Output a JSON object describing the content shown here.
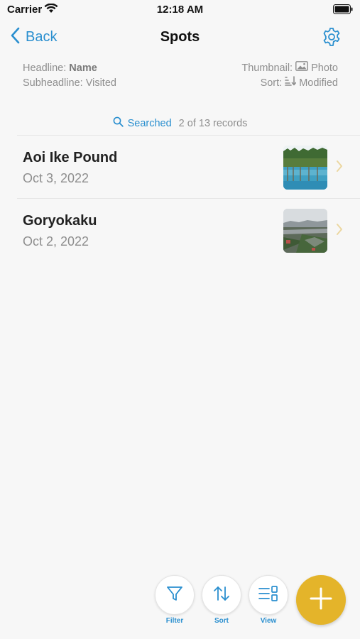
{
  "status_bar": {
    "carrier": "Carrier",
    "time": "12:18 AM"
  },
  "nav": {
    "back_label": "Back",
    "title": "Spots"
  },
  "meta": {
    "headline_label": "Headline:",
    "headline_value": "Name",
    "subheadline_label": "Subheadline:",
    "subheadline_value": "Visited",
    "thumbnail_label": "Thumbnail:",
    "thumbnail_value": "Photo",
    "sort_label": "Sort:",
    "sort_value": "Modified"
  },
  "search_summary": {
    "label": "Searched",
    "count": "2 of 13 records"
  },
  "records": [
    {
      "title": "Aoi Ike Pound",
      "subtitle": "Oct 3, 2022"
    },
    {
      "title": "Goryokaku",
      "subtitle": "Oct 2, 2022"
    }
  ],
  "toolbar": {
    "filter_label": "Filter",
    "sort_label": "Sort",
    "view_label": "View"
  },
  "colors": {
    "accent": "#2a8fcf",
    "add_button": "#e4b42a",
    "background": "#f7f7f7"
  }
}
